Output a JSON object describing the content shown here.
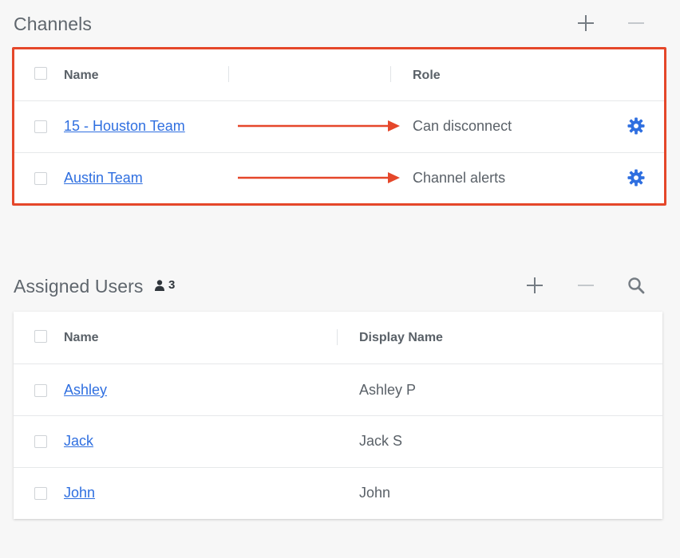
{
  "channels": {
    "title": "Channels",
    "add_icon": "plus-icon",
    "remove_icon": "minus-icon",
    "headers": {
      "name": "Name",
      "role": "Role"
    },
    "rows": [
      {
        "name": "15 - Houston Team",
        "role": "Can disconnect",
        "settings_icon": "gear-icon"
      },
      {
        "name": "Austin Team",
        "role": "Channel alerts",
        "settings_icon": "gear-icon"
      }
    ],
    "highlight_color": "#e5472a",
    "arrow_color": "#e5472a"
  },
  "assigned_users": {
    "title": "Assigned Users",
    "count": "3",
    "count_icon": "user-icon",
    "add_icon": "plus-icon",
    "remove_icon": "minus-icon",
    "search_icon": "search-icon",
    "headers": {
      "name": "Name",
      "display_name": "Display Name"
    },
    "rows": [
      {
        "name": "Ashley",
        "display_name": "Ashley P"
      },
      {
        "name": "Jack",
        "display_name": "Jack S"
      },
      {
        "name": "John",
        "display_name": "John"
      }
    ]
  },
  "colors": {
    "link": "#2f6fe0",
    "gear": "#2f6fe0",
    "background": "#f7f7f7",
    "card": "#ffffff"
  }
}
